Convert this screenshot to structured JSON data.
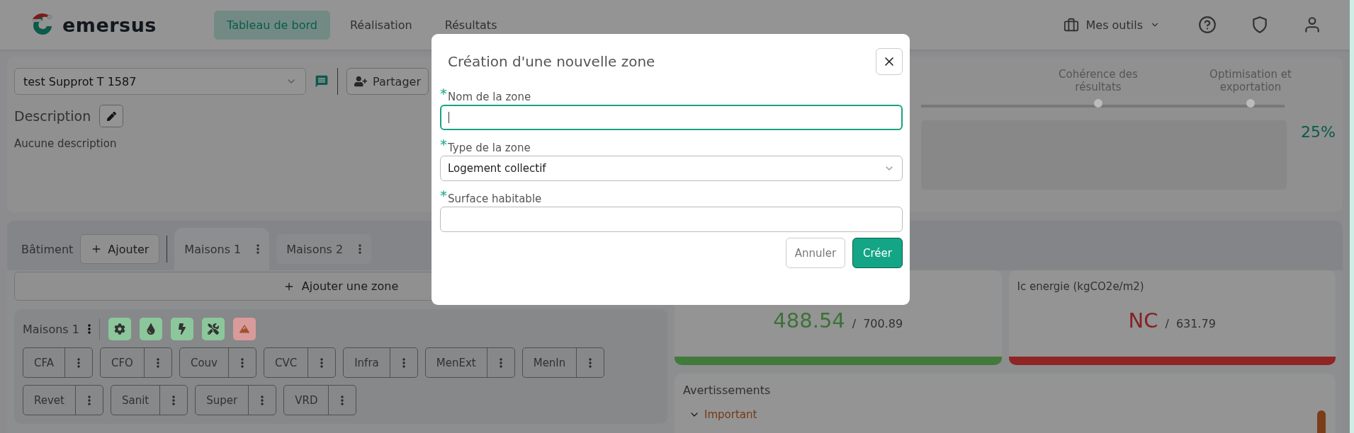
{
  "header": {
    "logo": "emersus",
    "nav": [
      {
        "label": "Tableau de bord",
        "selected": true
      },
      {
        "label": "Réalisation",
        "selected": false
      },
      {
        "label": "Résultats",
        "selected": false
      }
    ],
    "tools": "Mes outils"
  },
  "project": {
    "name": "test Supprot T 1587",
    "share": "Partager",
    "description_label": "Description",
    "description": "Aucune description"
  },
  "steps": [
    {
      "label": "Cohérence des résultats"
    },
    {
      "label": "Optimisation et exportation"
    }
  ],
  "progress": "25%",
  "building_label": "Bâtiment",
  "add_button": "Ajouter",
  "tabs": [
    {
      "label": "Maisons 1",
      "selected": true
    },
    {
      "label": "Maisons 2",
      "selected": false
    }
  ],
  "add_zone": "Ajouter une zone",
  "zone": {
    "name": "Maisons 1",
    "status": [
      {
        "kind": "gear",
        "color": "#8cc79b"
      },
      {
        "kind": "drop",
        "color": "#8cc79b"
      },
      {
        "kind": "bolt",
        "color": "#8cc79b"
      },
      {
        "kind": "tools",
        "color": "#8cc79b"
      },
      {
        "kind": "mountain",
        "color": "#d99a9a"
      }
    ],
    "lots": [
      "CFA",
      "CFO",
      "Couv",
      "CVC",
      "Infra",
      "MenExt",
      "MenIn",
      "Revet",
      "Sanit",
      "Super",
      "VRD"
    ]
  },
  "metrics": [
    {
      "value": "488.54",
      "separator": "/",
      "limit": "700.89",
      "color": "#427a3c"
    },
    {
      "title": "Ic energie (kgCO2e/m2)",
      "value": "NC",
      "separator": "/",
      "limit": "631.79",
      "color": "#8e2626"
    }
  ],
  "warnings": {
    "title": "Avertissements",
    "groups": [
      {
        "label": "Important",
        "expanded": true
      }
    ]
  },
  "modal": {
    "title": "Création d'une nouvelle zone",
    "fields": [
      {
        "label": "Nom de la zone",
        "marker": "*",
        "kind": "input",
        "focused": true
      },
      {
        "label": "Type de la zone",
        "marker": "*",
        "kind": "select",
        "value": "Logement collectif",
        "focused": false
      },
      {
        "label": "Surface habitable",
        "marker": "*",
        "kind": "input",
        "focused": false
      }
    ],
    "cancel": "Annuler",
    "submit": "Créer"
  }
}
